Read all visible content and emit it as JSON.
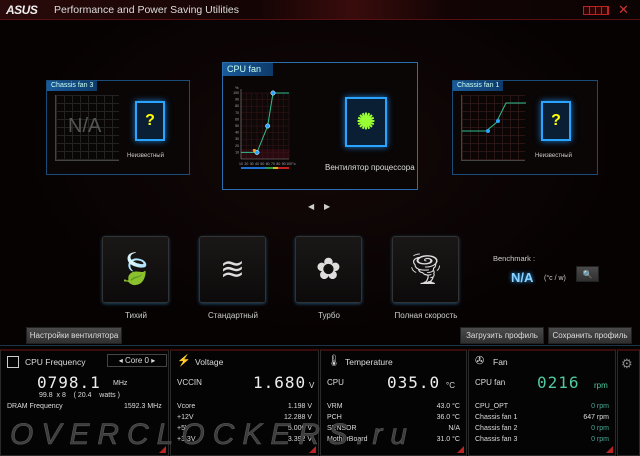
{
  "header": {
    "logo": "ASUS",
    "title": "Performance and Power Saving Utilities",
    "close": "✕"
  },
  "cards": {
    "left": {
      "tab": "Chassis fan 3",
      "na": "N/A",
      "name": "Неизвестный"
    },
    "center": {
      "tab": "CPU fan",
      "name": "Вентилятор процессора",
      "y_unit": "%",
      "x_unit": "°c",
      "y_ticks": [
        "10",
        "20",
        "30",
        "40",
        "50",
        "60",
        "70",
        "80",
        "90",
        "100"
      ],
      "x_ticks": [
        "10",
        "20",
        "30",
        "40",
        "50",
        "60",
        "70",
        "80",
        "90",
        "100"
      ],
      "fan_curve": [
        [
          10,
          10
        ],
        [
          40,
          10
        ],
        [
          60,
          50
        ],
        [
          70,
          100
        ],
        [
          100,
          100
        ]
      ]
    },
    "right": {
      "tab": "Chassis fan 1",
      "name": "Неизвестный"
    }
  },
  "nav": {
    "prev": "◀",
    "next": "▶"
  },
  "modes": [
    {
      "label": "Тихий",
      "icon": "🍃"
    },
    {
      "label": "Стандартный",
      "icon": "≋"
    },
    {
      "label": "Турбо",
      "icon": "✿"
    },
    {
      "label": "Полная скорость",
      "icon": "🌪"
    }
  ],
  "benchmark": {
    "label": "Benchmark :",
    "value": "N/A",
    "unit": "(°c / w)"
  },
  "buttons": {
    "fan_settings": "Настройки вентилятора",
    "load_profile": "Загрузить профиль",
    "save_profile": "Сохранить профиль"
  },
  "cpu_freq": {
    "title": "CPU Frequency",
    "core": "Core 0",
    "value": "0798.1",
    "unit": "MHz",
    "detail": "99.8  x 8    ( 20.4    watts )",
    "dram_label": "DRAM Frequency",
    "dram_value": "1592.3  MHz"
  },
  "voltage": {
    "title": "Voltage",
    "main_label": "VCCIN",
    "main_value": "1.680",
    "main_unit": "V",
    "rows": [
      {
        "l": "Vcore",
        "v": "1.198  V"
      },
      {
        "l": "+12V",
        "v": "12.288  V"
      },
      {
        "l": "+5V",
        "v": "5.000  V"
      },
      {
        "l": "+3.3V",
        "v": "3.392  V"
      }
    ]
  },
  "temperature": {
    "title": "Temperature",
    "main_label": "CPU",
    "main_value": "035.0",
    "main_unit": "°C",
    "rows": [
      {
        "l": "VRM",
        "v": "43.0 °C"
      },
      {
        "l": "PCH",
        "v": "36.0 °C"
      },
      {
        "l": "SENSOR",
        "v": "N/A"
      },
      {
        "l": "MotherBoard",
        "v": "31.0 °C"
      }
    ]
  },
  "fan": {
    "title": "Fan",
    "main_label": "CPU fan",
    "main_value": "0216",
    "main_unit": "rpm",
    "rows": [
      {
        "l": "CPU_OPT",
        "v": "0  rpm"
      },
      {
        "l": "Chassis fan 1",
        "v": "647  rpm"
      },
      {
        "l": "Chassis fan 2",
        "v": "0  rpm"
      },
      {
        "l": "Chassis fan 3",
        "v": "0  rpm"
      }
    ]
  },
  "watermark": "OVERCLOCKERS.ru",
  "colors": {
    "accent": "#29a4ff",
    "curve": "#2fbf8f",
    "fan_value": "#4fc9a0",
    "red": "#b22222"
  }
}
